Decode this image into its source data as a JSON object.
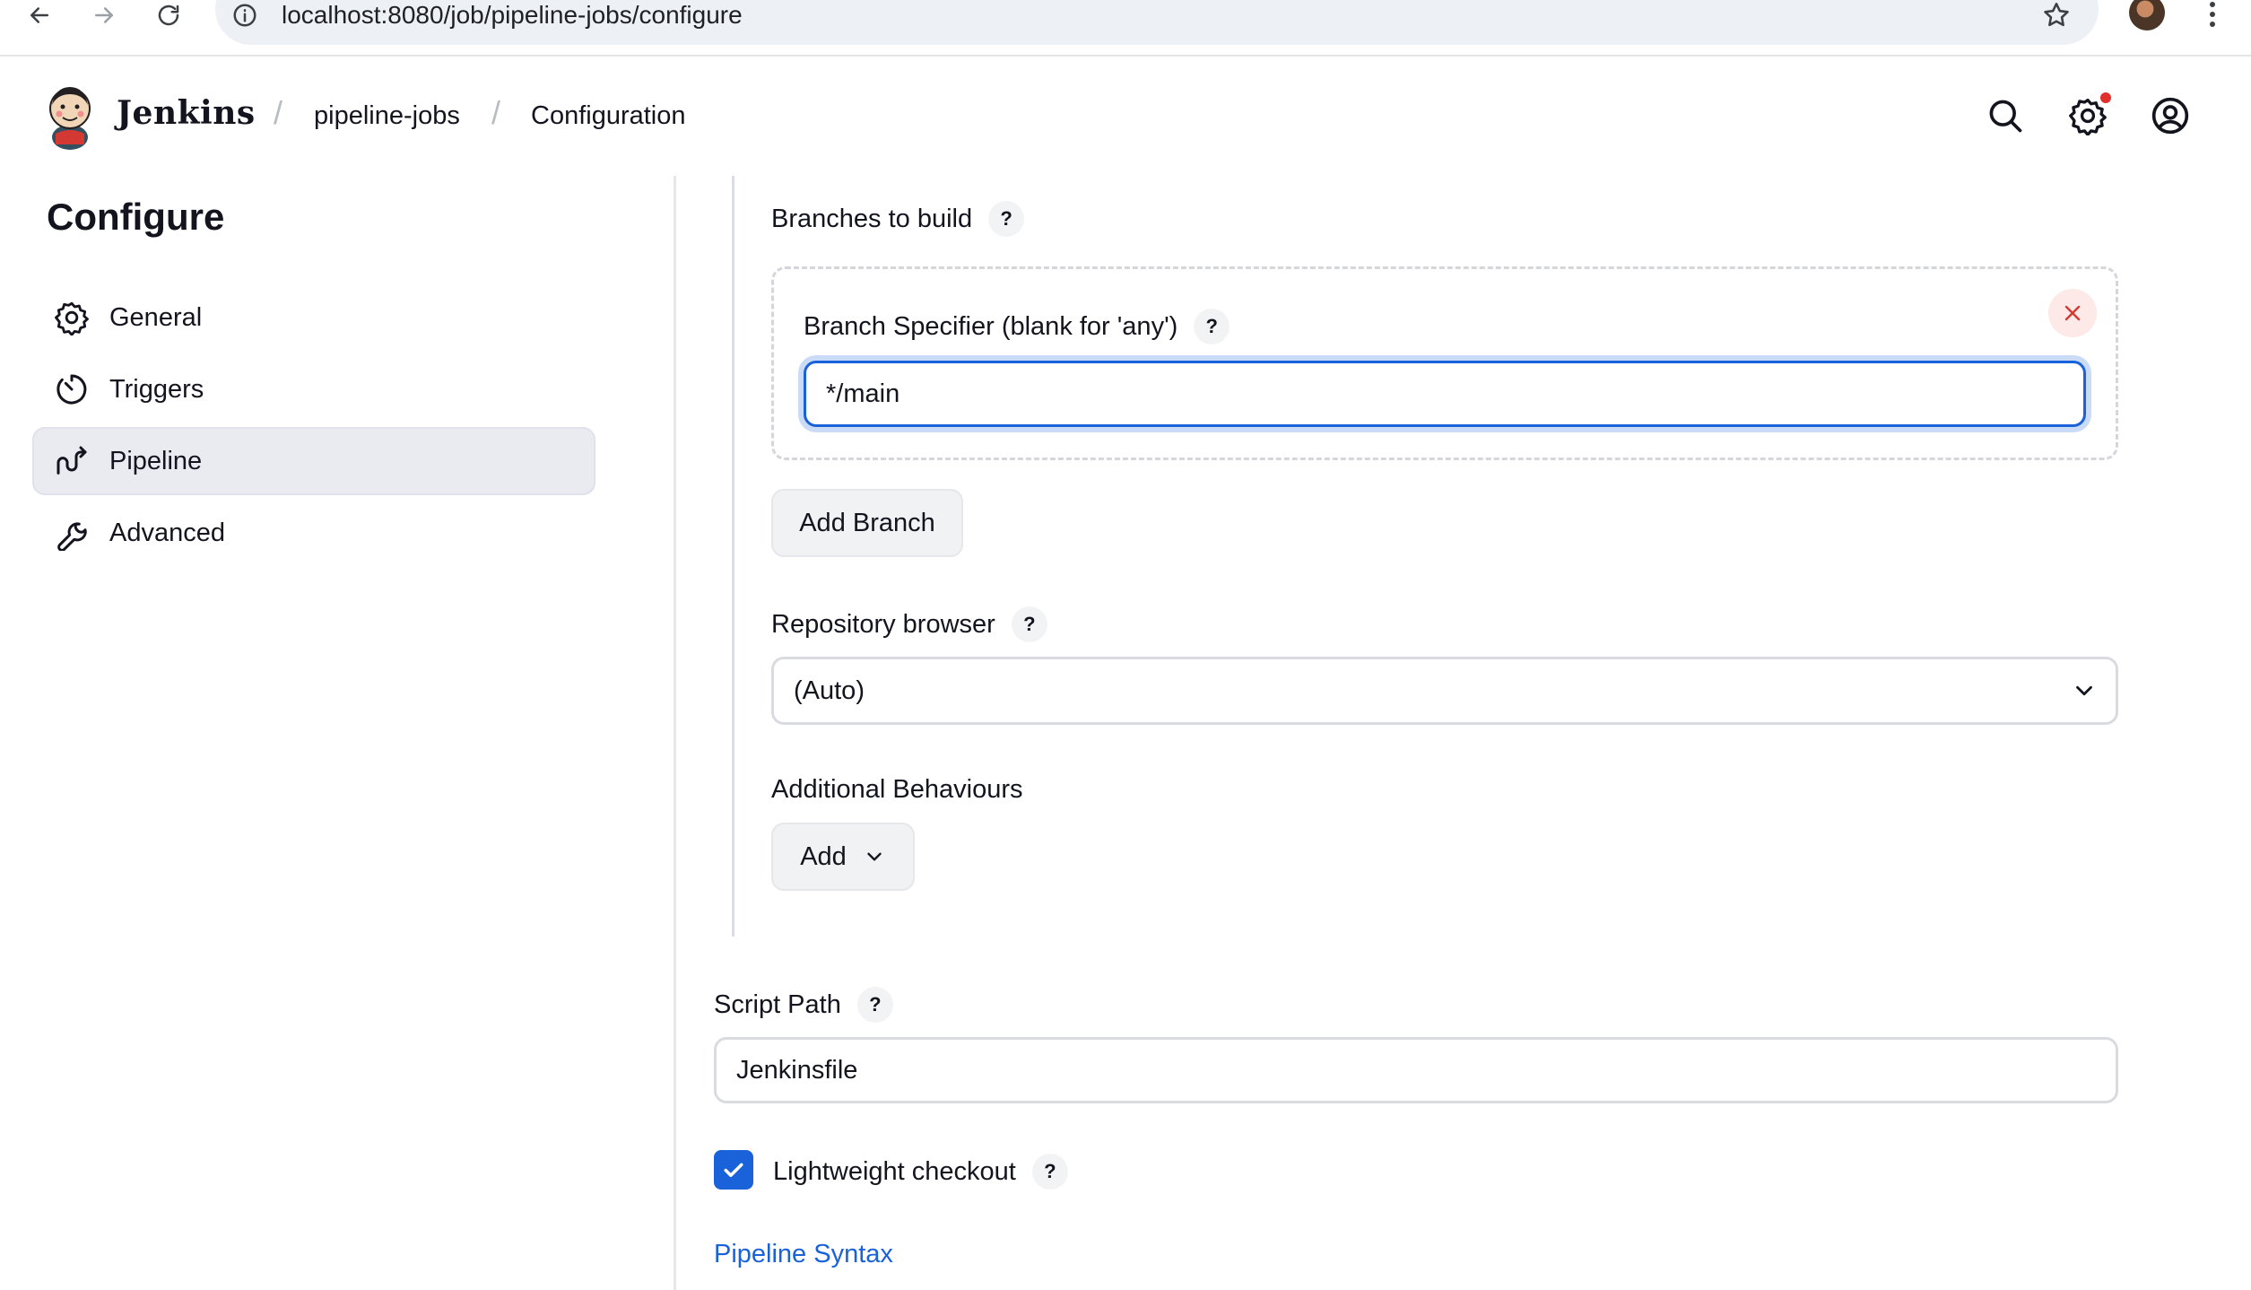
{
  "browser": {
    "url": "localhost:8080/job/pipeline-jobs/configure"
  },
  "header": {
    "brand": "Jenkins",
    "breadcrumbs": [
      {
        "label": "pipeline-jobs"
      },
      {
        "label": "Configuration"
      }
    ]
  },
  "sidebar": {
    "title": "Configure",
    "items": [
      {
        "label": "General",
        "icon": "gear-icon",
        "active": false
      },
      {
        "label": "Triggers",
        "icon": "timer-icon",
        "active": false
      },
      {
        "label": "Pipeline",
        "icon": "pipeline-icon",
        "active": true
      },
      {
        "label": "Advanced",
        "icon": "wrench-icon",
        "active": false
      }
    ]
  },
  "main": {
    "branches": {
      "label": "Branches to build",
      "help": "?",
      "specifier_label": "Branch Specifier (blank for 'any')",
      "specifier_help": "?",
      "specifier_value": "*/main",
      "add_branch_label": "Add Branch"
    },
    "repository_browser": {
      "label": "Repository browser",
      "help": "?",
      "selected": "(Auto)"
    },
    "additional_behaviours": {
      "label": "Additional Behaviours",
      "add_label": "Add"
    },
    "script_path": {
      "label": "Script Path",
      "help": "?",
      "value": "Jenkinsfile"
    },
    "lightweight_checkout": {
      "label": "Lightweight checkout",
      "help": "?",
      "checked": true
    },
    "pipeline_syntax_link": "Pipeline Syntax"
  },
  "colors": {
    "accent": "#1a62d9",
    "active_bg": "#e9ebf1",
    "delete_bg": "#fde9e8",
    "delete_fg": "#d33a32",
    "notification": "#e0302b"
  }
}
